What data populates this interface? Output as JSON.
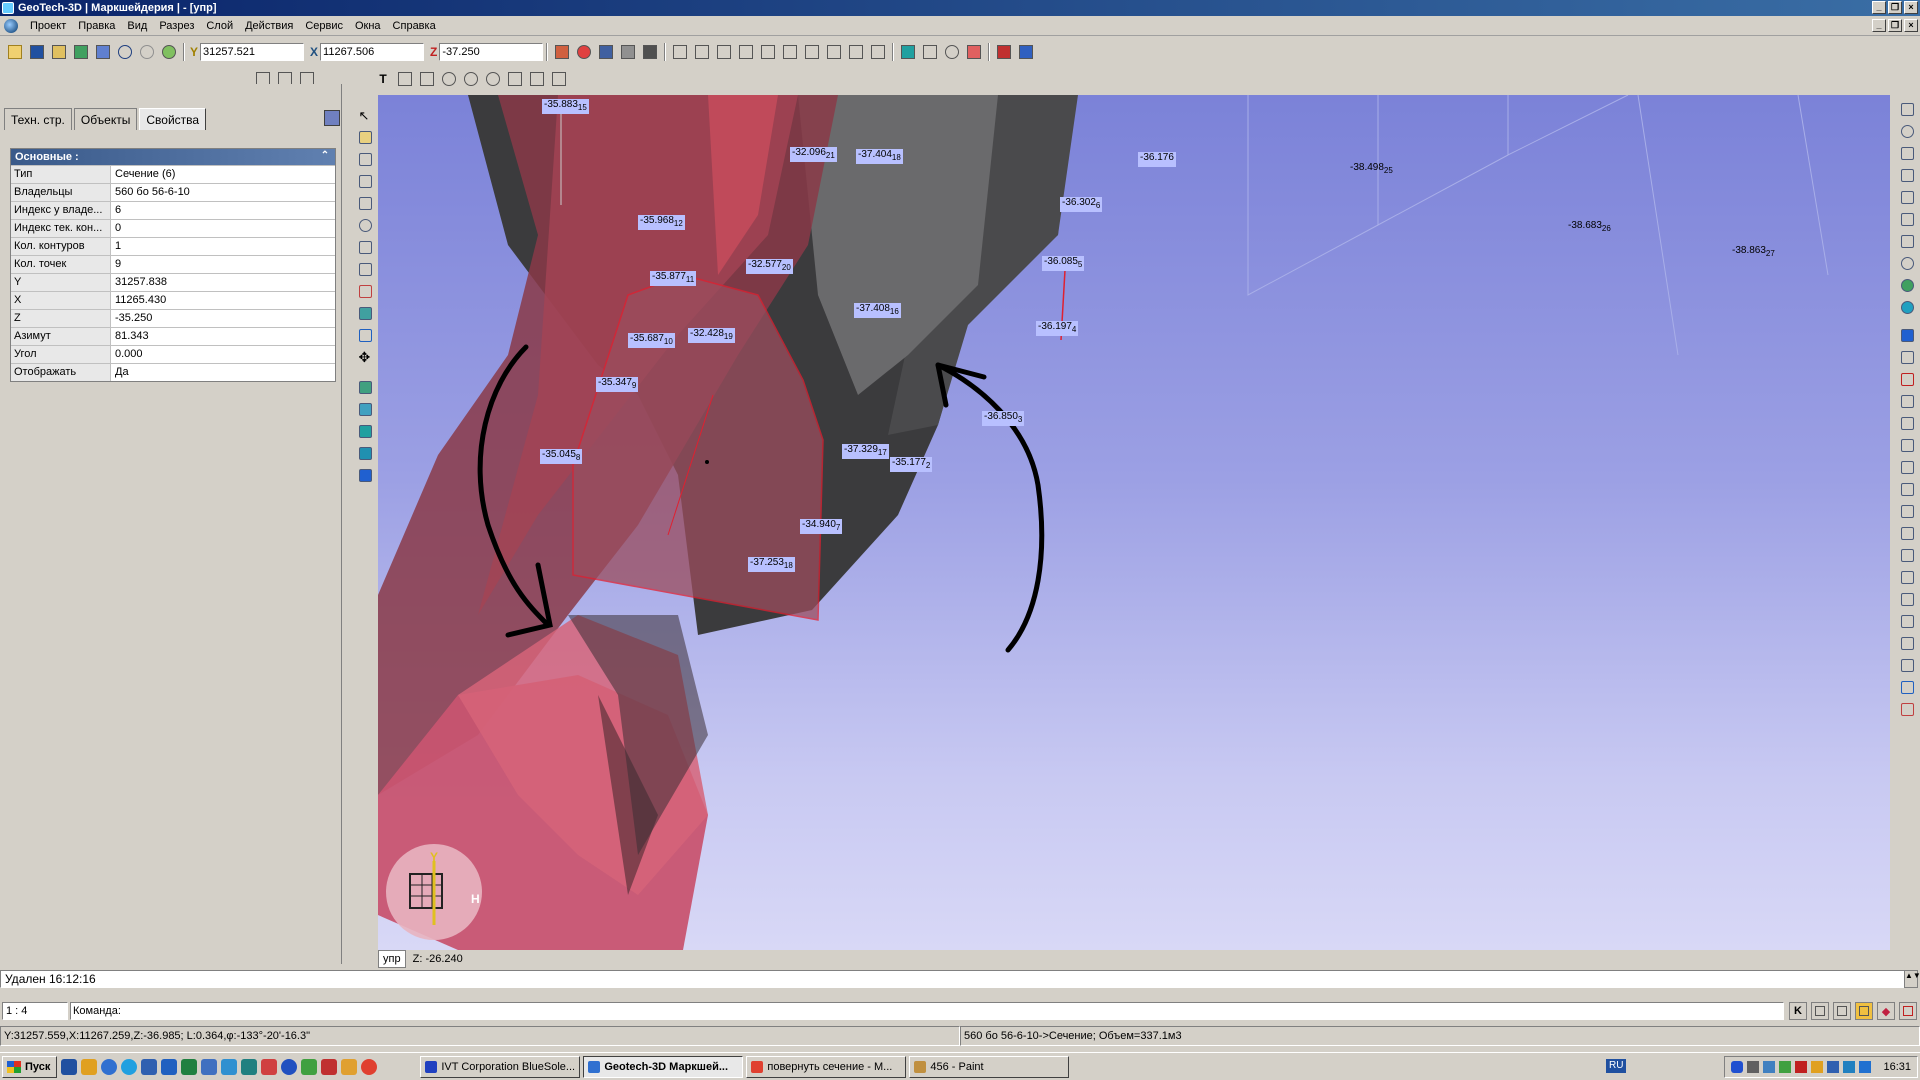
{
  "window": {
    "title": "GeoTech-3D | Маркшейдерия | - [упр]"
  },
  "menu": [
    "Проект",
    "Правка",
    "Вид",
    "Разрез",
    "Слой",
    "Действия",
    "Сервис",
    "Окна",
    "Справка"
  ],
  "coords": {
    "y_label": "Y",
    "y_value": "31257.521",
    "x_label": "X",
    "x_value": "11267.506",
    "z_label": "Z",
    "z_value": "-37.250"
  },
  "panel": {
    "tabs": [
      "Техн. стр.",
      "Объекты",
      "Свойства"
    ],
    "active_tab": "Свойства",
    "section_title": "Основные :",
    "properties": [
      {
        "key": "Тип",
        "value": "Сечение (6)"
      },
      {
        "key": "Владельцы",
        "value": "560 бо 56-6-10"
      },
      {
        "key": "Индекс у владе...",
        "value": "6"
      },
      {
        "key": "Индекс тек. кон...",
        "value": "0"
      },
      {
        "key": "Кол. контуров",
        "value": "1"
      },
      {
        "key": "Кол. точек",
        "value": "9"
      },
      {
        "key": "Y",
        "value": "31257.838"
      },
      {
        "key": "X",
        "value": "11265.430"
      },
      {
        "key": "Z",
        "value": "-35.250"
      },
      {
        "key": "Азимут",
        "value": "81.343"
      },
      {
        "key": "Угол",
        "value": "0.000"
      },
      {
        "key": "Отображать",
        "value": "Да"
      }
    ]
  },
  "viewport": {
    "elevations": [
      {
        "v": "-35.883",
        "s": "15"
      },
      {
        "v": "-32.096",
        "s": "21"
      },
      {
        "v": "-37.404",
        "s": "18"
      },
      {
        "v": "-36.176",
        "s": ""
      },
      {
        "v": "-38.498",
        "s": "25"
      },
      {
        "v": "-36.302",
        "s": "6"
      },
      {
        "v": "-35.968",
        "s": "12"
      },
      {
        "v": "-38.683",
        "s": "26"
      },
      {
        "v": "-38.863",
        "s": "27"
      },
      {
        "v": "-32.577",
        "s": "20"
      },
      {
        "v": "-36.085",
        "s": "5"
      },
      {
        "v": "-35.877",
        "s": "11"
      },
      {
        "v": "-37.408",
        "s": "16"
      },
      {
        "v": "-36.197",
        "s": "4"
      },
      {
        "v": "-35.687",
        "s": "10"
      },
      {
        "v": "-32.428",
        "s": "19"
      },
      {
        "v": "-35.347",
        "s": "9"
      },
      {
        "v": "-36.850",
        "s": "3"
      },
      {
        "v": "-35.045",
        "s": "8"
      },
      {
        "v": "-37.329",
        "s": "17"
      },
      {
        "v": "-35.177",
        "s": "2"
      },
      {
        "v": "-34.940",
        "s": "7"
      },
      {
        "v": "-37.253",
        "s": "18"
      }
    ],
    "compass_y": "Y",
    "compass_h": "H",
    "tab_label": "упр",
    "z_readout": "Z: -26.240"
  },
  "command": {
    "message": "Удален 16:12:16",
    "scale": "1 : 4",
    "prompt": "Команда:"
  },
  "status": {
    "cursor": "Y:31257.559,X:11267.259,Z:-36.985; L:0.364,φ:-133°-20'-16.3\"",
    "object": "560 бо 56-6-10->Сечение; Объем=337.1м3"
  },
  "taskbar": {
    "start": "Пуск",
    "tasks": [
      "IVT Corporation BlueSole...",
      "Geotech-3D Маркшей...",
      "повернуть сечение - M...",
      "456 - Paint"
    ],
    "active_task": 1,
    "lang": "RU",
    "clock": "16:31"
  },
  "colors": {
    "section_fill": "#9b4d5e",
    "body_red": "#d4586e",
    "body_dark": "#3a3a3a",
    "sky": "#8a8fe0",
    "title_bar": "#0a246a"
  }
}
